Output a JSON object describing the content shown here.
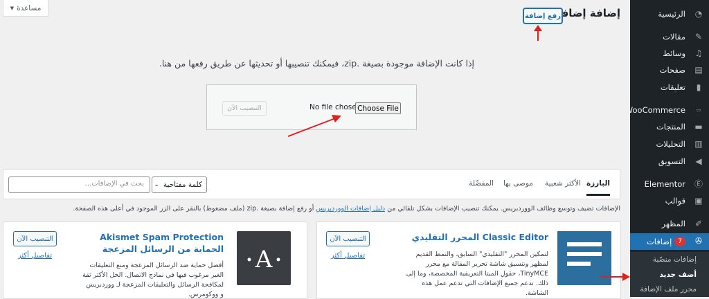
{
  "sidebar": {
    "items": [
      {
        "label": "الرئيسية",
        "icon": "dashboard-icon"
      },
      {
        "label": "مقالات",
        "icon": "pin-icon"
      },
      {
        "label": "وسائط",
        "icon": "media-icon"
      },
      {
        "label": "صفحات",
        "icon": "pages-icon"
      },
      {
        "label": "تعليقات",
        "icon": "comments-icon"
      },
      {
        "label": "WooCommerce",
        "icon": "woo-icon"
      },
      {
        "label": "المنتجات",
        "icon": "products-icon"
      },
      {
        "label": "التحليلات",
        "icon": "analytics-icon"
      },
      {
        "label": "التسويق",
        "icon": "megaphone-icon"
      },
      {
        "label": "Elementor",
        "icon": "elementor-icon"
      },
      {
        "label": "قوالب",
        "icon": "templates-icon"
      },
      {
        "label": "المظهر",
        "icon": "appearance-icon"
      },
      {
        "label": "إضافات",
        "icon": "plugins-icon",
        "badge": "7"
      }
    ],
    "sub_items": [
      "إضافات منصّبة",
      "أضف جديد",
      "محرر ملف الإضافة"
    ]
  },
  "help_tab": {
    "label": "مساعدة",
    "icon": "caret-down-icon"
  },
  "header": {
    "title": "إضافة إضافات",
    "upload_button": "رفع إضافة"
  },
  "upload": {
    "description": "إذا كانت الإضافة موجودة بصيغة .zip، فيمكنك تنصيبها أو تحديثها عن طريق رفعها من هنا.",
    "choose_file": "Choose File",
    "no_file": "No file chosen",
    "install_now": "التنصيب الآن"
  },
  "filter": {
    "tabs": [
      "البارزة",
      "الأكثر شعبية",
      "موصى بها",
      "المفضّلة"
    ],
    "search_type": "كلمة مفتاحية",
    "search_placeholder": "بحث في الإضافات..."
  },
  "intro": {
    "text_before": "الإضافات تضيف وتوسع وظائف الووردبريس. يمكنك تنصيب الإضافات بشكل تلقائي من",
    "link": "دليل إضافات الووردبريس",
    "text_after": "أو رفع إضافة بصيغة .zip (ملف مضغوط) بالنقر على الزر الموجود في أعلى هذه الصفحة."
  },
  "cards": [
    {
      "title_en": "Classic Editor",
      "title_ar": "المحرر التقليدي",
      "description": "لتمكين المحرر \"التقليدي\" السابق، والنمط القديم لمظهر وتنسيق شاشة تحرير المقالة مع محرر TinyMCE، حقول الميتا التعريفية المخصصة، وما إلى ذلك. تدعم جميع الإضافات التي تدعم عمل هذه الشاشة.",
      "install": "التنصيب الآن",
      "details": "تفاصيل أكثر"
    },
    {
      "title_en": "Akismet Spam Protection",
      "title_ar": "الحماية من الرسائل المزعجة",
      "description": "أفضل حماية ضد الرسائل المزعجة ومنع التعليقات الغير مرغوب فيها في نماذج الاتصال. الحل الأكثر ثقة لمكافحة الرسائل والتعليقات المزعجة لـ ووردبريس و ووكومرس.",
      "install": "التنصيب الآن",
      "details": "تفاصيل أكثر"
    }
  ],
  "colors": {
    "sidebar_bg": "#1d2327",
    "accent": "#2271b1",
    "arrow": "#e0201f",
    "badge": "#d63638"
  }
}
